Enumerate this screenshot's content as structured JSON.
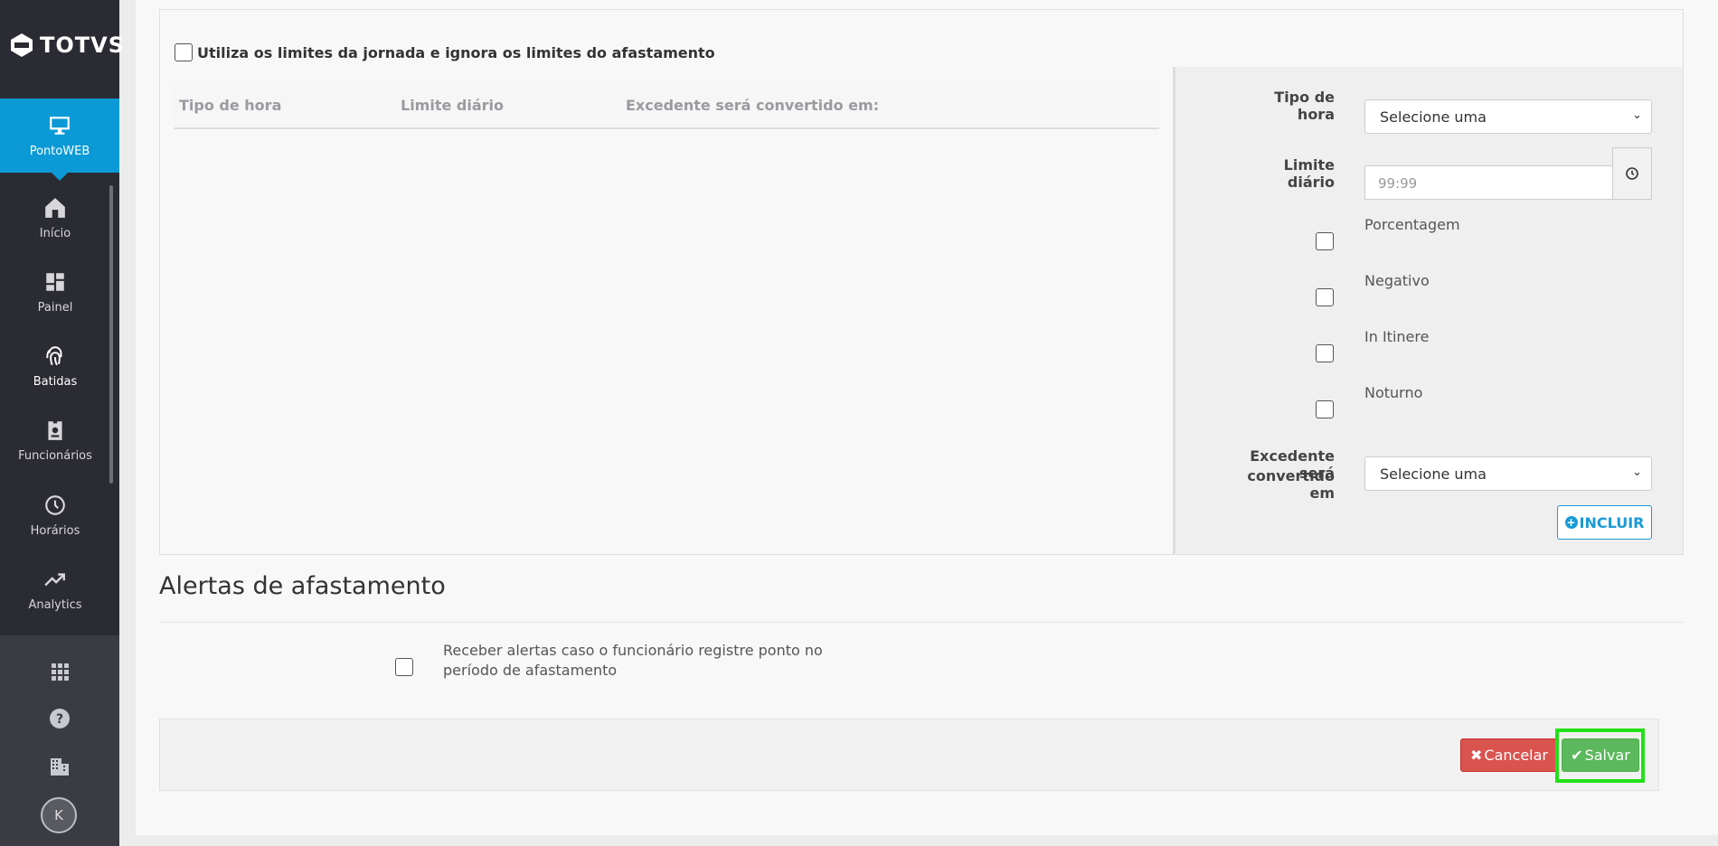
{
  "sidebar": {
    "logo_text": "TOTVS",
    "active_item": {
      "label": "PontoWEB",
      "icon": "monitor-icon"
    },
    "items": [
      {
        "label": "Início",
        "icon": "home-icon"
      },
      {
        "label": "Painel",
        "icon": "dashboard-icon"
      },
      {
        "label": "Batidas",
        "icon": "fingerprint-icon"
      },
      {
        "label": "Funcionários",
        "icon": "badge-icon"
      },
      {
        "label": "Horários",
        "icon": "clock-icon"
      },
      {
        "label": "Analytics",
        "icon": "trend-icon"
      }
    ],
    "bottom_icons": [
      "apps-grid-icon",
      "help-icon",
      "building-icon"
    ],
    "avatar_initial": "K"
  },
  "limits": {
    "use_journey_limits_label": "Utiliza os limites da jornada e ignora os limites do afastamento",
    "table": {
      "columns": [
        "Tipo de hora",
        "Limite diário",
        "Excedente será convertido em:"
      ],
      "rows": []
    }
  },
  "form": {
    "tipo_hora_label": "Tipo de hora",
    "tipo_hora_value": "Selecione uma",
    "limite_label": "Limite diário",
    "limite_placeholder": "99:99",
    "options": [
      "Porcentagem",
      "Negativo",
      "In Itinere",
      "Noturno"
    ],
    "excedente_label_1": "Excedente será",
    "excedente_label_2": "convertido em",
    "excedente_value": "Selecione uma",
    "incluir_label": "INCLUIR"
  },
  "alerts": {
    "title": "Alertas de afastamento",
    "checkbox_text": "Receber alertas caso o funcionário registre ponto no período de afastamento"
  },
  "footer": {
    "cancel_label": "Cancelar",
    "save_label": "Salvar",
    "colors": {
      "cancel": "#d9534f",
      "save": "#5cb85c",
      "highlight": "#22e018",
      "accent": "#0c9ad6"
    }
  }
}
